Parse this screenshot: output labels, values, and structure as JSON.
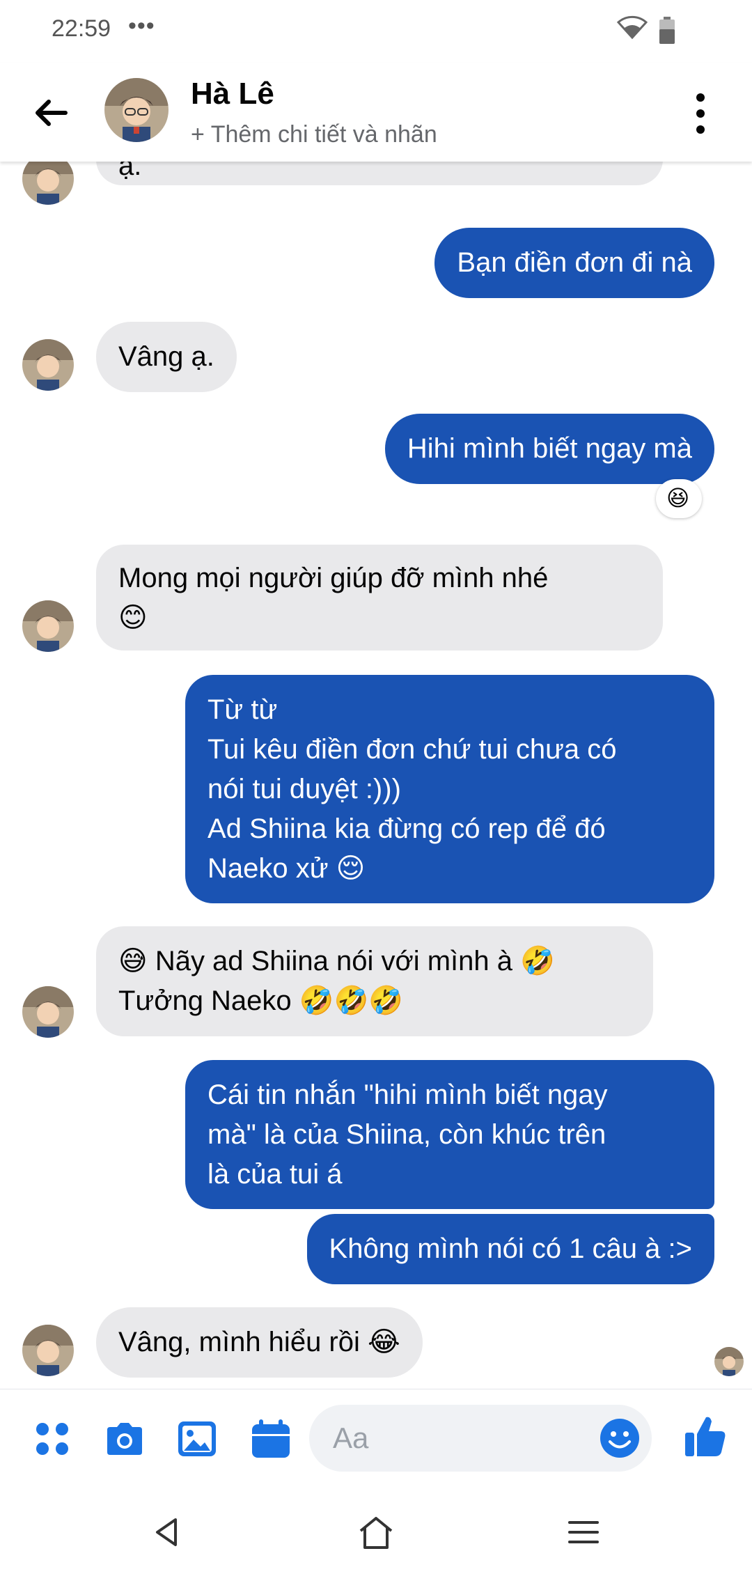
{
  "status_bar": {
    "time": "22:59",
    "dots": "•••",
    "icons": [
      "wifi-icon",
      "battery-icon"
    ]
  },
  "header": {
    "name": "Hà Lê",
    "subtitle": "+ Thêm chi tiết và nhãn",
    "icons": [
      "back-arrow-icon",
      "more-vertical-icon"
    ]
  },
  "messages": [
    {
      "from": "them",
      "text": "ạ."
    },
    {
      "from": "me",
      "text": "Bạn điền đơn đi nà"
    },
    {
      "from": "them",
      "text": "Vâng ạ."
    },
    {
      "from": "me",
      "text": "Hihi mình biết ngay mà",
      "reaction": "😆"
    },
    {
      "from": "them",
      "text": "Mong mọi người giúp đỡ mình nhé\n😊"
    },
    {
      "from": "me",
      "text": "Từ từ\nTui kêu điền đơn chứ tui chưa có\nnói tui duyệt :)))\nAd Shiina kia đừng có rep để đó\nNaeko xử 😌"
    },
    {
      "from": "them",
      "text": "😅 Nãy ad Shiina nói với mình à 🤣\nTưởng Naeko 🤣🤣🤣"
    },
    {
      "from": "me",
      "text": "Cái tin nhắn \"hihi mình biết ngay\nmà\" là của Shiina, còn khúc trên\nlà của tui á"
    },
    {
      "from": "me",
      "text": "Không mình nói có 1 câu à :>"
    },
    {
      "from": "them",
      "text": "Vâng, mình hiểu rồi 😂"
    }
  ],
  "composer": {
    "placeholder": "Aa",
    "icons": [
      "menu-grid-icon",
      "camera-icon",
      "gallery-icon",
      "calendar-icon",
      "emoji-icon",
      "like-icon"
    ]
  },
  "colors": {
    "outgoing_bubble": "#1a53b3",
    "incoming_bubble": "#e9e9eb",
    "accent": "#1b74e4"
  }
}
